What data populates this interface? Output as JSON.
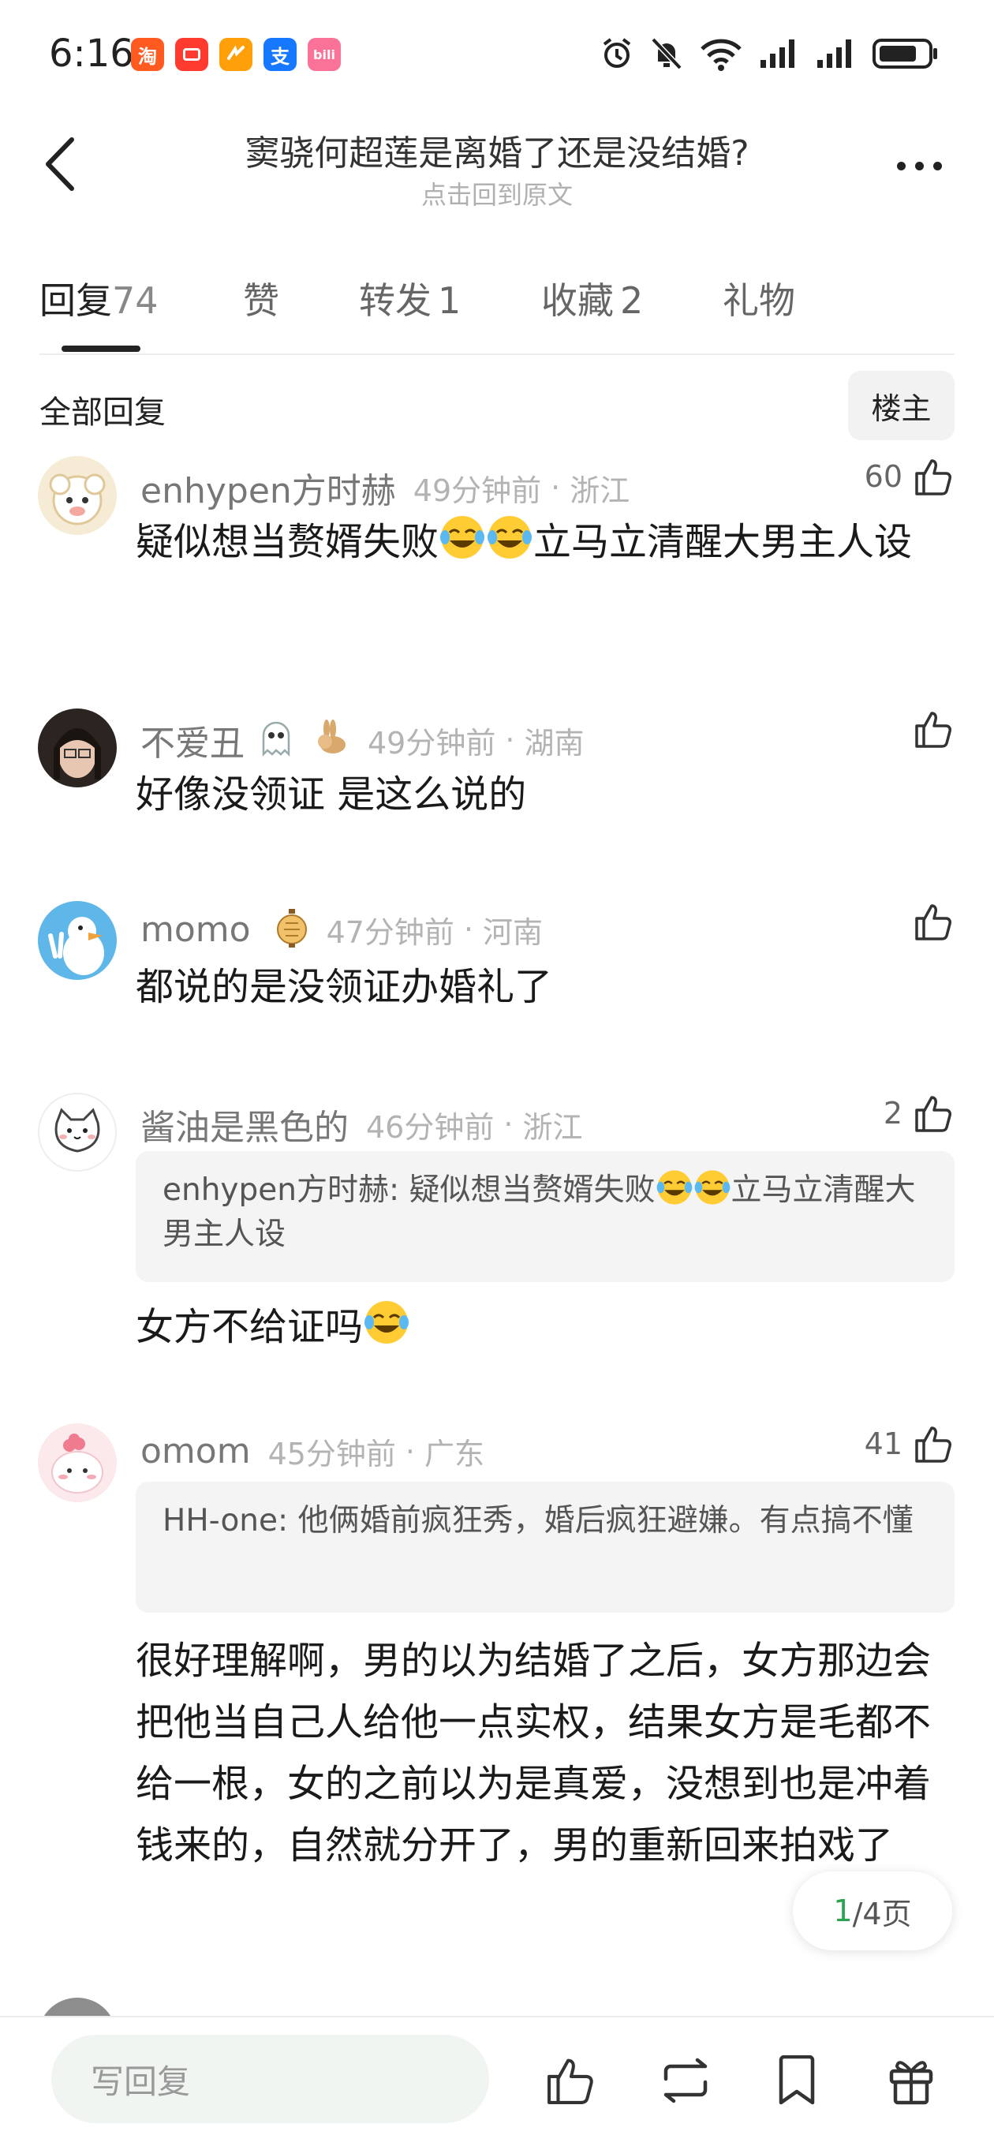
{
  "status_bar": {
    "time": "6:16",
    "app_icons": [
      {
        "name": "taobao-app-icon",
        "glyph": "淘",
        "color": "#ff5a1f"
      },
      {
        "name": "red-app-icon",
        "glyph": "■",
        "color": "#ff3b30"
      },
      {
        "name": "orange-app-icon",
        "glyph": "∽",
        "color": "#ff9f0a"
      },
      {
        "name": "alipay-app-icon",
        "glyph": "支",
        "color": "#1677ff"
      },
      {
        "name": "bilibili-app-icon",
        "glyph": "bili",
        "color": "#fb7299"
      }
    ]
  },
  "header": {
    "title": "窦骁何超莲是离婚了还是没结婚?",
    "subtitle": "点击回到原文"
  },
  "tabs": [
    {
      "label": "回复",
      "count": "74",
      "active": true
    },
    {
      "label": "赞",
      "count": "",
      "active": false
    },
    {
      "label": "转发",
      "count": "1",
      "active": false
    },
    {
      "label": "收藏",
      "count": "2",
      "active": false
    },
    {
      "label": "礼物",
      "count": "",
      "active": false
    }
  ],
  "filter": {
    "label": "全部回复",
    "owner_button": "楼主"
  },
  "comments": [
    {
      "username": "enhypen方时赫",
      "time": "49分钟前",
      "location": "浙江",
      "likes": "60",
      "text_before": "疑似想当赘婿失败",
      "text_after": "立马立清醒大男主人设",
      "emoji_count": 2
    },
    {
      "username": "不爱丑",
      "time": "49分钟前",
      "location": "湖南",
      "likes": "",
      "text": "好像没领证 是这么说的"
    },
    {
      "username": "momo",
      "time": "47分钟前",
      "location": "河南",
      "likes": "",
      "text": "都说的是没领证办婚礼了"
    },
    {
      "username": "酱油是黑色的",
      "time": "46分钟前",
      "location": "浙江",
      "likes": "2",
      "quote_user": "enhypen方时赫",
      "quote_before": "疑似想当赘婿失败",
      "quote_after": "立马立清醒大男主人设",
      "text": "女方不给证吗"
    },
    {
      "username": "omom",
      "time": "45分钟前",
      "location": "广东",
      "likes": "41",
      "quote_user": "HH-one",
      "quote_text": "他俩婚前疯狂秀，婚后疯狂避嫌。有点搞不懂",
      "text": "很好理解啊，男的以为结婚了之后，女方那边会把他当自己人给他一点实权，结果女方是毛都不给一根，女的之前以为是真爱，没想到也是冲着钱来的，自然就分开了，男的重新回来拍戏了"
    }
  ],
  "pager": {
    "current": "1",
    "total": "/4页"
  },
  "bottom_bar": {
    "reply_placeholder": "写回复"
  },
  "colors": {
    "accent_green": "#2aa44f",
    "text_primary": "#1a1a1a",
    "text_muted": "#b3b3b3"
  }
}
